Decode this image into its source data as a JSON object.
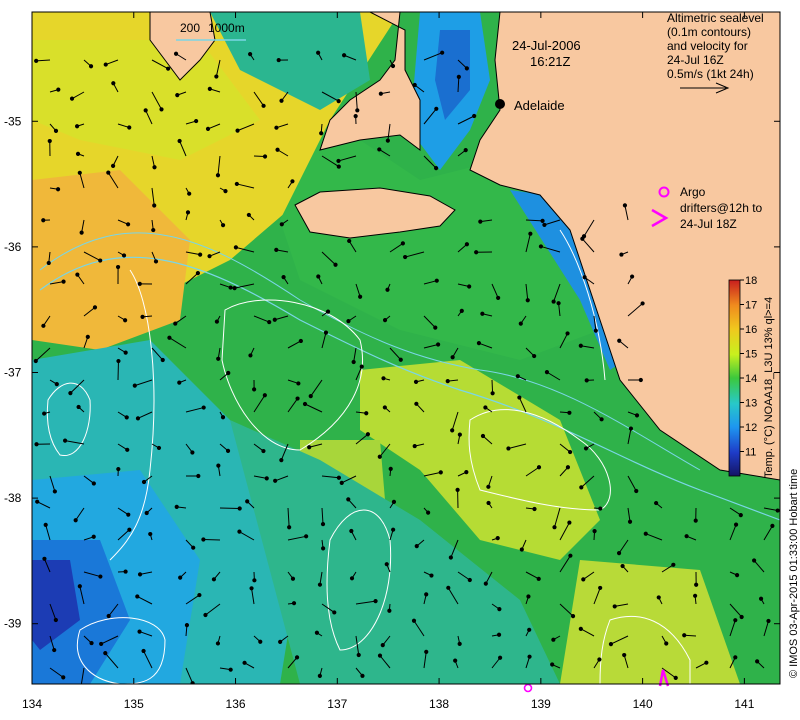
{
  "map": {
    "date": "24-Jul-2006",
    "time": "16:21Z",
    "city": "Adelaide",
    "scale_bar_labels": [
      "200",
      "1000m"
    ],
    "legend": {
      "lines": [
        "Altimetric sealevel",
        "(0.1m contours)",
        "and velocity for",
        "24-Jul 16Z",
        "0.5m/s (1kt 24h)"
      ]
    },
    "argo": {
      "lines": [
        "Argo",
        "drifters@12h to",
        "24-Jul 18Z"
      ]
    },
    "colorbar": {
      "title": "Temp. (°C) NOAA18_L3U 13% ql>=4",
      "ticks": [
        "11",
        "12",
        "13",
        "14",
        "15",
        "16",
        "17",
        "18"
      ],
      "min": 10,
      "max": 18
    },
    "credit": "© IMOS 03-Apr-2015 01:33:00 Hobart time",
    "x_ticks": [
      "134",
      "135",
      "136",
      "137",
      "138",
      "139",
      "140",
      "141"
    ],
    "y_ticks": [
      "-35",
      "-36",
      "-37",
      "-38",
      "-39"
    ],
    "x_range": [
      134,
      141.35
    ],
    "y_range": [
      -39.48,
      -34.13
    ],
    "colors": {
      "land": "#f8c8a0",
      "coast": "#000000",
      "argo": "#ff00ff",
      "contour": "#ffffff",
      "bathy": "#7ad6e6"
    }
  }
}
